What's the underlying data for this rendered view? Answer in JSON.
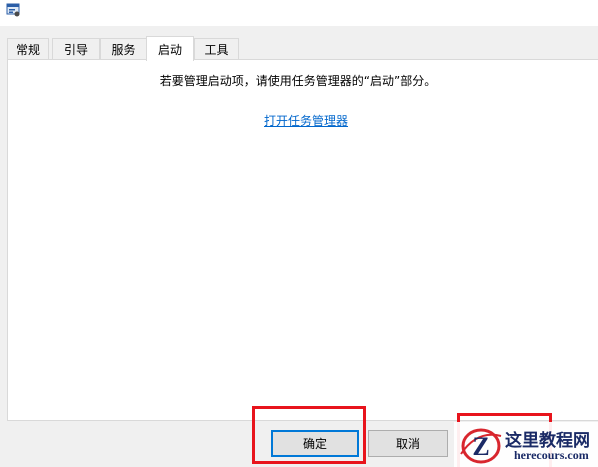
{
  "tabs": [
    {
      "label": "常规"
    },
    {
      "label": "引导"
    },
    {
      "label": "服务"
    },
    {
      "label": "启动",
      "active": true
    },
    {
      "label": "工具"
    }
  ],
  "startup": {
    "message": "若要管理启动项，请使用任务管理器的“启动”部分。",
    "link": "打开任务管理器"
  },
  "buttons": {
    "ok": "确定",
    "cancel": "取消"
  },
  "watermark": {
    "title": "这里教程网",
    "url": "herecours.com"
  },
  "colors": {
    "link": "#0066cc",
    "highlight_box": "#e8141c",
    "focus": "#0078d7"
  },
  "icons": {
    "app": "msconfig-window-icon",
    "watermark_logo": "z-logo-icon"
  }
}
